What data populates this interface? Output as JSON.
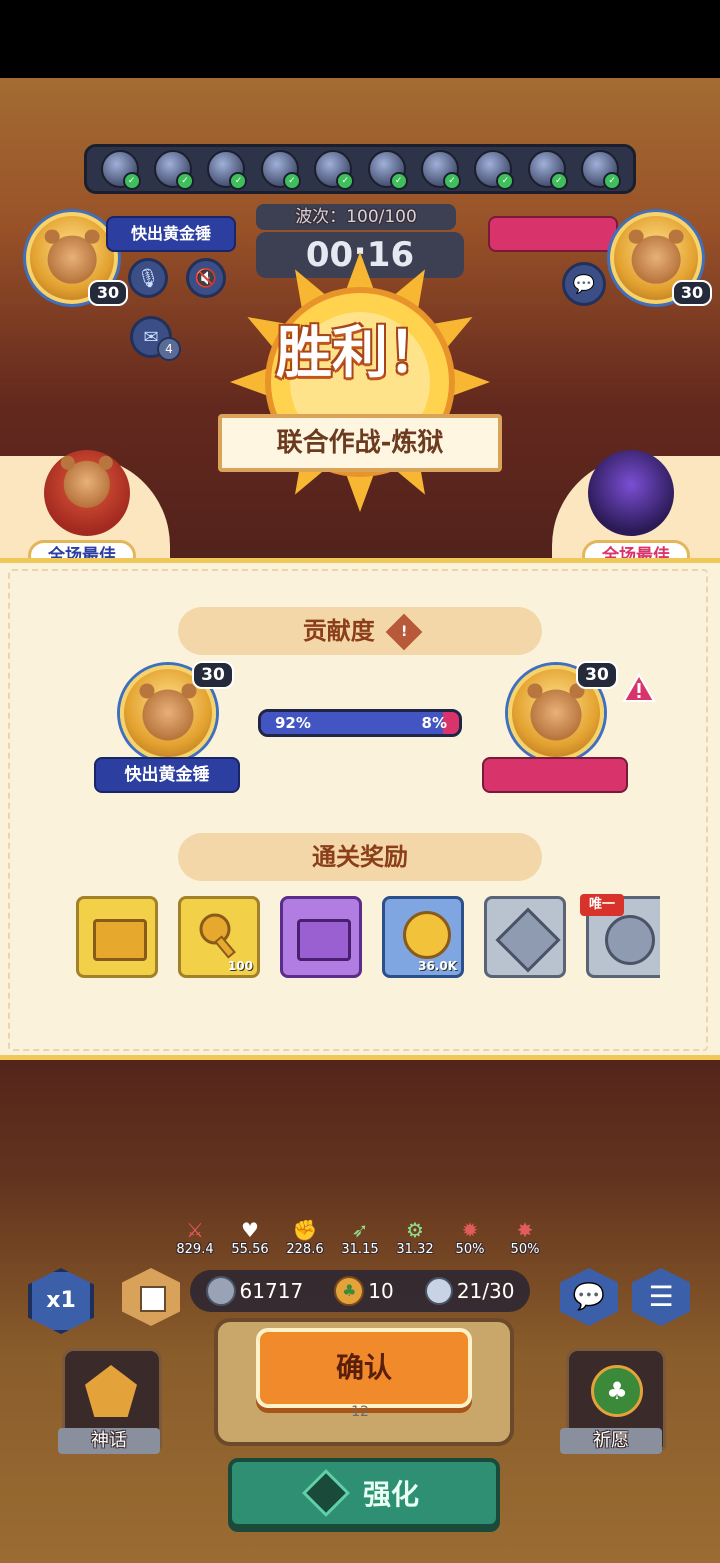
{
  "battle": {
    "wave_label": "波次：100/100",
    "timer": "00:16",
    "victory_title": "胜利！",
    "mode_banner": "联合作战-炼狱"
  },
  "player_left": {
    "name": "快出黄金锤",
    "level": "30",
    "mail_count": "4"
  },
  "player_right": {
    "level": "30"
  },
  "mvp": {
    "left_label": "全场最佳",
    "right_label": "全场最佳"
  },
  "contribution": {
    "title": "贡献度",
    "left": {
      "level": "30",
      "name": "快出黄金锤",
      "percent_label": "92%"
    },
    "right": {
      "level": "30",
      "percent_label": "8%"
    },
    "left_fraction": 0.92
  },
  "rewards": {
    "title": "通关奖励",
    "items": [
      {
        "icon": "gold-chest-icon",
        "count": ""
      },
      {
        "icon": "gold-key-icon",
        "count": "100"
      },
      {
        "icon": "purple-chest-icon",
        "count": ""
      },
      {
        "icon": "gold-coin-icon",
        "count": "36.0K"
      },
      {
        "icon": "silver-emblem-icon",
        "count": ""
      },
      {
        "icon": "silver-medal-icon",
        "count": "",
        "tag": "唯一"
      }
    ]
  },
  "stats": [
    "829.4",
    "55.56",
    "228.6",
    "31.15",
    "31.32",
    "50%",
    "50%"
  ],
  "resources": {
    "silver": "61717",
    "clover": "10",
    "units": "21/30"
  },
  "speed_label": "x1",
  "confirm_label": "确认",
  "myth_label": "神话",
  "wish_label": "祈愿",
  "enhance_label": "强化",
  "under_confirm": "12",
  "colors": {
    "panel_bg": "#fbf2dc",
    "name_blue": "#2c3fa0",
    "pink": "#d8336b",
    "confirm": "#f08a2a",
    "enhance": "#2f8f72"
  }
}
